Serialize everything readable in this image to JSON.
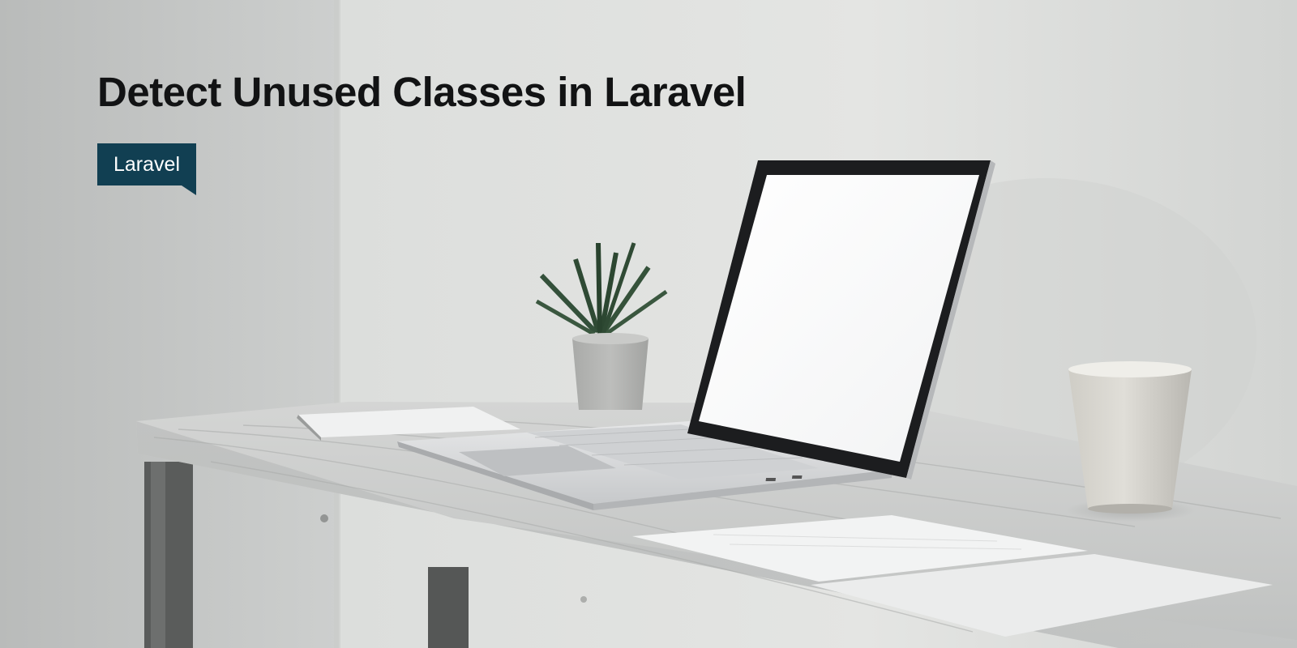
{
  "article": {
    "title": "Detect Unused Classes in Laravel",
    "tag": "Laravel"
  },
  "colors": {
    "tag_background": "#113f52",
    "title_text": "#121314",
    "wall": "#e0e2e0"
  }
}
